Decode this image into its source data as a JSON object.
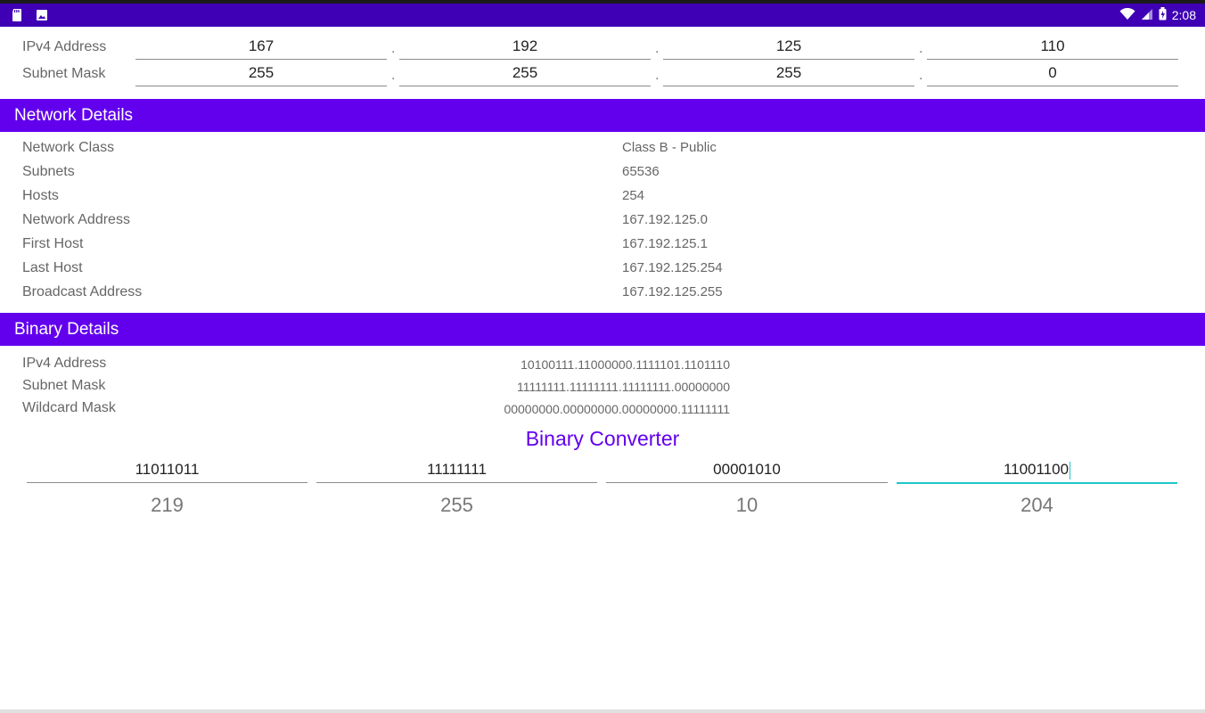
{
  "status_bar": {
    "time": "2:08",
    "icons": [
      "sd-card-icon",
      "image-icon",
      "wifi-icon",
      "cell-signal-icon",
      "battery-icon"
    ],
    "background": "#3f00b5"
  },
  "ip_inputs": {
    "ipv4": {
      "label": "IPv4 Address",
      "octets": [
        "167",
        "192",
        "125",
        "110"
      ]
    },
    "subnet": {
      "label": "Subnet Mask",
      "octets": [
        "255",
        "255",
        "255",
        "0"
      ]
    },
    "separator": "."
  },
  "network_details": {
    "header": "Network Details",
    "rows": [
      {
        "label": "Network Class",
        "value": "Class B - Public"
      },
      {
        "label": "Subnets",
        "value": "65536"
      },
      {
        "label": "Hosts",
        "value": "254"
      },
      {
        "label": "Network Address",
        "value": "167.192.125.0"
      },
      {
        "label": "First Host",
        "value": "167.192.125.1"
      },
      {
        "label": "Last Host",
        "value": "167.192.125.254"
      },
      {
        "label": "Broadcast Address",
        "value": "167.192.125.255"
      }
    ]
  },
  "binary_details": {
    "header": "Binary Details",
    "rows": [
      {
        "label": "IPv4 Address",
        "value": "10100111.11000000.1111101.1101110"
      },
      {
        "label": "Subnet Mask",
        "value": "11111111.11111111.11111111.00000000"
      },
      {
        "label": "Wildcard Mask",
        "value": "00000000.00000000.00000000.11111111"
      }
    ]
  },
  "binary_converter": {
    "title": "Binary Converter",
    "inputs": [
      "11011011",
      "11111111",
      "00001010",
      "11001100"
    ],
    "outputs": [
      "219",
      "255",
      "10",
      "204"
    ]
  },
  "colors": {
    "accent": "#6200ee",
    "focus_underline": "#1fc7c7"
  }
}
